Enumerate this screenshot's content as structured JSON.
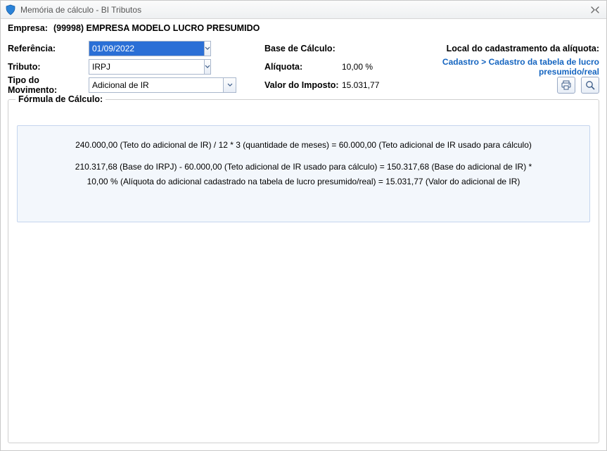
{
  "window": {
    "title": "Memória de cálculo - BI Tributos"
  },
  "empresaLabel": "Empresa:",
  "empresaValue": "(99998) EMPRESA MODELO LUCRO PRESUMIDO",
  "form": {
    "referencia_label": "Referência:",
    "referencia_value": "01/09/2022",
    "tributo_label": "Tributo:",
    "tributo_value": "IRPJ",
    "tipo_mov_label": "Tipo do Movimento:",
    "tipo_mov_value": "Adicional de IR",
    "base_calc_label": "Base de Cálculo:",
    "base_calc_value": "",
    "aliquota_label": "Alíquota:",
    "aliquota_value": "10,00  %",
    "valor_imposto_label": "Valor do Imposto:",
    "valor_imposto_value": "15.031,77",
    "local_label": "Local do cadastramento da alíquota:",
    "local_link": "Cadastro > Cadastro da tabela de lucro presumido/real"
  },
  "formulaLegend": "Fórmula de Cálculo:",
  "formula": {
    "line1": "240.000,00 (Teto do adicional de IR) / 12 * 3 (quantidade de meses) = 60.000,00 (Teto adicional de IR usado para cálculo)",
    "line2": "210.317,68 (Base do IRPJ) - 60.000,00 (Teto adicional de IR usado para cálculo) = 150.317,68 (Base do adicional de IR) *",
    "line3": "10,00 % (Alíquota do adicional cadastrado na tabela de lucro presumido/real) = 15.031,77 (Valor do adicional de IR)"
  }
}
